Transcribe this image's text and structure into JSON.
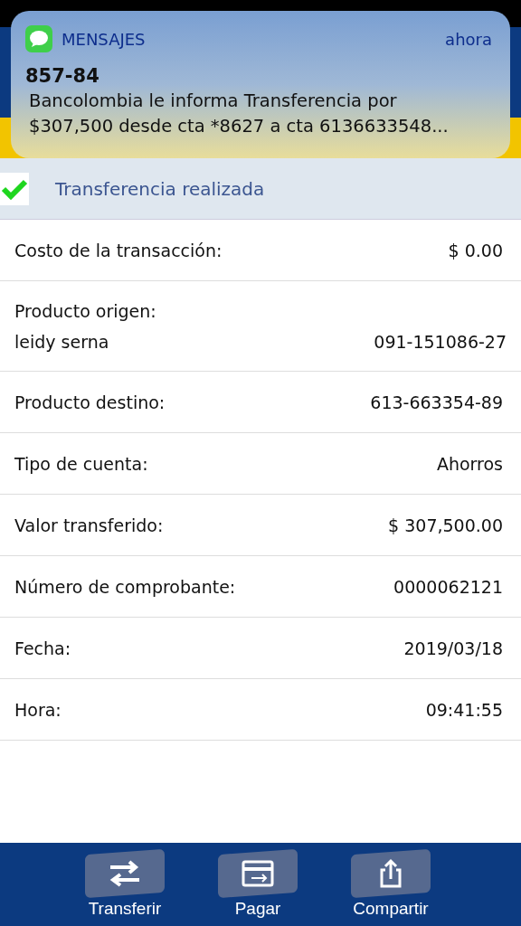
{
  "notification": {
    "app": "MENSAJES",
    "time": "ahora",
    "sender": "857-84",
    "message": "Bancolombia le informa Transferencia por $307,500 desde cta *8627 a cta 6136633548..."
  },
  "status": {
    "text": "Transferencia realizada",
    "success": true
  },
  "rows": [
    {
      "kind": "inline",
      "label": "Costo de la transacción:",
      "value": "$ 0.00"
    },
    {
      "kind": "stacked",
      "label": "Producto origen:",
      "name": "leidy serna",
      "value": "091-151086-27"
    },
    {
      "kind": "inline",
      "label": "Producto destino:",
      "value": "613-663354-89"
    },
    {
      "kind": "inline",
      "label": "Tipo de cuenta:",
      "value": "Ahorros"
    },
    {
      "kind": "inline",
      "label": "Valor transferido:",
      "value": "$ 307,500.00"
    },
    {
      "kind": "inline",
      "label": "Número de comprobante:",
      "value": "0000062121"
    },
    {
      "kind": "inline",
      "label": "Fecha:",
      "value": "2019/03/18"
    },
    {
      "kind": "inline",
      "label": "Hora:",
      "value": "09:41:55"
    }
  ],
  "nav": [
    {
      "label": "Transferir",
      "kind": "transfer"
    },
    {
      "label": "Pagar",
      "kind": "pay"
    },
    {
      "label": "Compartir",
      "kind": "share"
    }
  ]
}
